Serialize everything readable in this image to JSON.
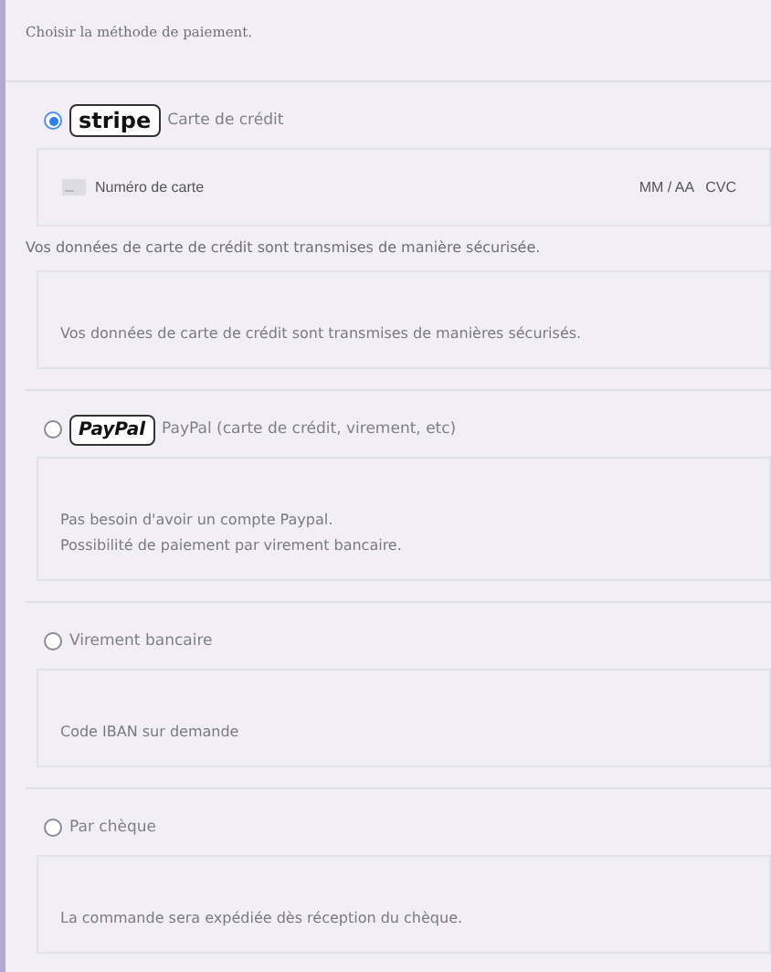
{
  "intro": "Choisir la méthode de paiement.",
  "methods": [
    {
      "selected": true,
      "kind": "stripe",
      "logo": "stripe",
      "label": "Carte de crédit",
      "card_field": {
        "placeholder": "Numéro de carte",
        "expiry": "MM / AA",
        "cvc": "CVC"
      },
      "note": "Vos données de carte de crédit sont transmises de manière sécurisée.",
      "description": [
        "Vos données de carte de crédit sont transmises de manières sécurisés."
      ]
    },
    {
      "selected": false,
      "kind": "paypal",
      "logo": "PayPal",
      "label": "PayPal (carte de crédit, virement, etc)",
      "description": [
        "Pas besoin d'avoir un compte Paypal.",
        "Possibilité de paiement par virement bancaire."
      ]
    },
    {
      "selected": false,
      "label": "Virement bancaire",
      "description": [
        "Code IBAN sur demande"
      ]
    },
    {
      "selected": false,
      "label": "Par chèque",
      "description": [
        "La commande sera expédiée dès réception du chèque."
      ]
    }
  ]
}
